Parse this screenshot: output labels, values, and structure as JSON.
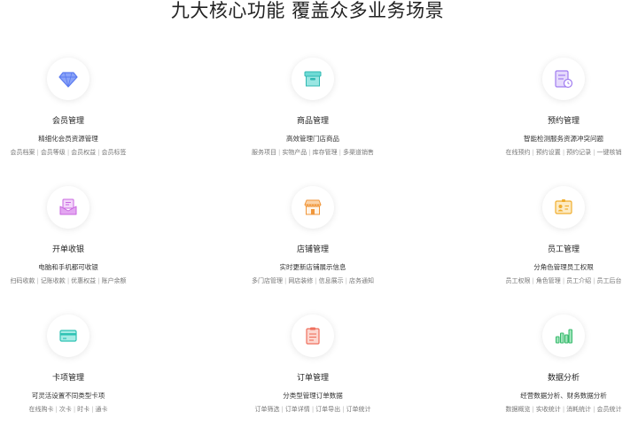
{
  "title": "九大核心功能 覆盖众多业务场景",
  "features": [
    {
      "title": "会员管理",
      "desc": "精细化会员资源管理",
      "icon": "diamond-icon",
      "color": "#6d8cf5",
      "tags": [
        "会员档案",
        "会员等级",
        "会员权益",
        "会员标签"
      ]
    },
    {
      "title": "商品管理",
      "desc": "高效管理门店商品",
      "icon": "box-icon",
      "color": "#3cc7c2",
      "tags": [
        "服务项目",
        "实物产品",
        "库存管理",
        "多渠道销售"
      ]
    },
    {
      "title": "预约管理",
      "desc": "智能检测服务资源冲突问题",
      "icon": "schedule-icon",
      "color": "#a97ef2",
      "tags": [
        "在线预约",
        "预约设置",
        "预约记录",
        "一键核销"
      ]
    },
    {
      "title": "开单收银",
      "desc": "电脑和手机都可收银",
      "icon": "envelope-icon",
      "color": "#d47be8",
      "tags": [
        "扫码收款",
        "记账收款",
        "优惠权益",
        "账户余额"
      ]
    },
    {
      "title": "店铺管理",
      "desc": "实时更新店铺展示信息",
      "icon": "store-icon",
      "color": "#f5a04a",
      "tags": [
        "多门店管理",
        "网店装修",
        "信息展示",
        "店务通知"
      ]
    },
    {
      "title": "员工管理",
      "desc": "分角色管理员工权限",
      "icon": "id-card-icon",
      "color": "#f3b741",
      "tags": [
        "员工权限",
        "角色管理",
        "员工介绍",
        "员工后台"
      ]
    },
    {
      "title": "卡项管理",
      "desc": "可灵活设置不同类型卡项",
      "icon": "card-icon",
      "color": "#3ccfc2",
      "tags": [
        "在线购卡",
        "次卡",
        "时卡",
        "通卡"
      ]
    },
    {
      "title": "订单管理",
      "desc": "分类型管理订单数据",
      "icon": "clipboard-icon",
      "color": "#f47f6e",
      "tags": [
        "订单筛选",
        "订单详情",
        "订单导出",
        "订单统计"
      ]
    },
    {
      "title": "数据分析",
      "desc": "经营数据分析、财务数据分析",
      "icon": "bar-chart-icon",
      "color": "#46c97b",
      "tags": [
        "数据概览",
        "实收统计",
        "消耗统计",
        "会员统计"
      ]
    }
  ]
}
